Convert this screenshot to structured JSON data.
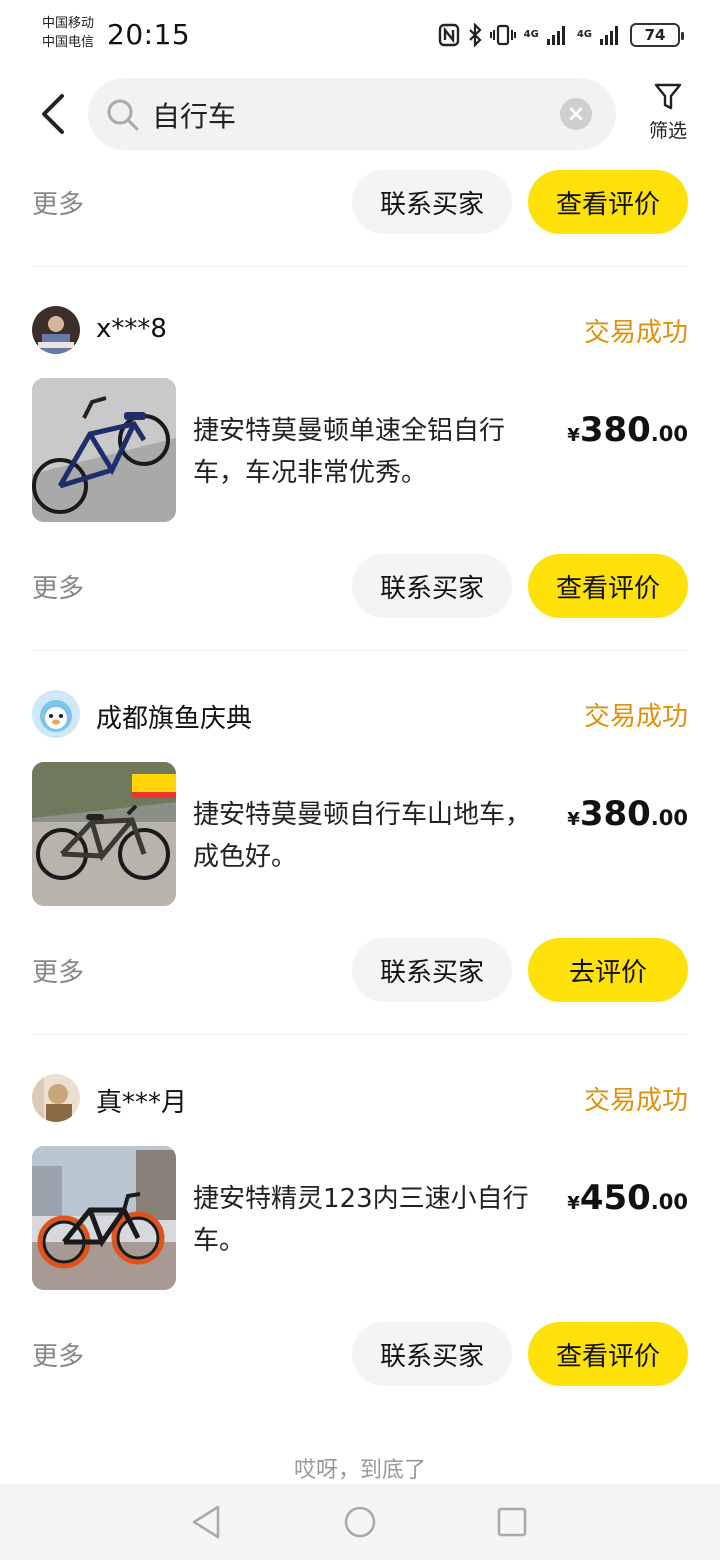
{
  "status_bar": {
    "carrier1": "中国移动",
    "carrier2": "中国电信",
    "time": "20:15",
    "network1": "4G",
    "network2": "4G",
    "battery": "74"
  },
  "header": {
    "search_query": "自行车",
    "filter_label": "筛选"
  },
  "top_actions": {
    "more": "更多",
    "contact": "联系买家",
    "review": "查看评价"
  },
  "orders": [
    {
      "seller": "x***8",
      "status": "交易成功",
      "title": "捷安特莫曼顿单速全铝自行车，车况非常优秀。",
      "currency": "¥",
      "price_int": "380",
      "price_dec": ".00",
      "more": "更多",
      "contact": "联系买家",
      "review": "查看评价"
    },
    {
      "seller": "成都旗鱼庆典",
      "status": "交易成功",
      "title": "捷安特莫曼顿自行车山地车，成色好。",
      "currency": "¥",
      "price_int": "380",
      "price_dec": ".00",
      "more": "更多",
      "contact": "联系买家",
      "review": "去评价"
    },
    {
      "seller": "真***月",
      "status": "交易成功",
      "title": "捷安特精灵123内三速小自行车。",
      "currency": "¥",
      "price_int": "450",
      "price_dec": ".00",
      "more": "更多",
      "contact": "联系买家",
      "review": "查看评价"
    }
  ],
  "footer": {
    "end_tip": "哎呀，到底了"
  },
  "colors": {
    "accent_yellow": "#ffe10a",
    "status_orange": "#e0900b"
  }
}
